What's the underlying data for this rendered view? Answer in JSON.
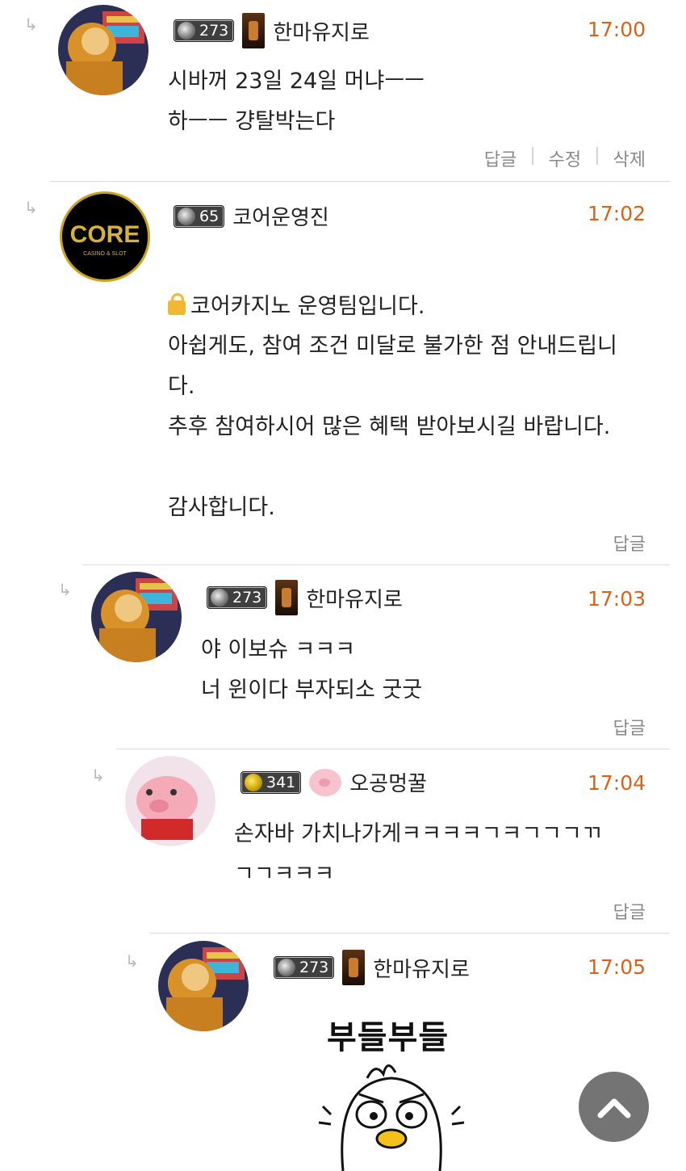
{
  "comments": [
    {
      "nickname": "한마유지로",
      "level": "273",
      "time": "17:00",
      "body": "시바꺼 23일 24일 머냐ㅡㅡ\n하ㅡㅡ 걍탈박는다",
      "actions": [
        "답글",
        "수정",
        "삭제"
      ]
    },
    {
      "nickname": "코어운영진",
      "level": "65",
      "time": "17:02",
      "lock_text": "코어카지노 운영팀입니다.",
      "body": "아쉽게도, 참여 조건 미달로 불가한 점 안내드립니\n다.\n추후 참여하시어 많은 혜택 받아보시길 바랍니다.\n\n감사합니다.",
      "logo_text": "CORE",
      "logo_sub": "CASINO & SLOT",
      "actions": [
        "답글"
      ]
    },
    {
      "nickname": "한마유지로",
      "level": "273",
      "time": "17:03",
      "body": "야 이보슈 ㅋㅋㅋ\n너 윈이다 부자되소 굿굿",
      "actions": [
        "답글"
      ]
    },
    {
      "nickname": "오공멍꿀",
      "level": "341",
      "time": "17:04",
      "body": "손자바 가치나가게ㅋㅋㅋㅋㄱㅋㄱㄱㄱㄲ\nㄱㄱㅋㅋㅋ",
      "actions": [
        "답글"
      ]
    },
    {
      "nickname": "한마유지로",
      "level": "273",
      "time": "17:05",
      "sticker_text": "부들부들"
    }
  ],
  "colors": {
    "time": "#d9621b",
    "scroll_button": "#6d6d6d"
  },
  "icons": {
    "reply_arrow": "reply-arrow-icon",
    "scroll_top": "chevron-up-icon"
  }
}
